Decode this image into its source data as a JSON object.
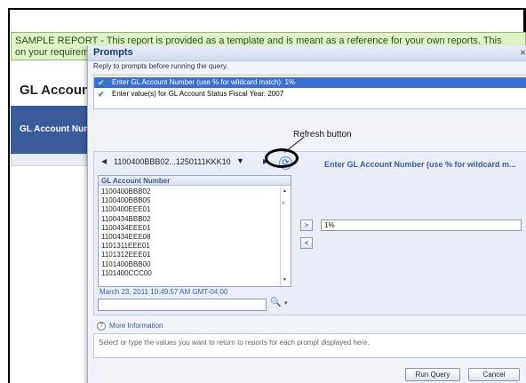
{
  "background": {
    "banner_line1": "SAMPLE REPORT - This report is provided as a template and is meant as a reference for your own reports. This",
    "banner_line2": "on your requirements",
    "report_title": "GL Account",
    "column_header": "GL Account Number"
  },
  "dialog": {
    "title": "Prompts",
    "close_glyph": "×",
    "subtitle": "Reply to prompts before running the query.",
    "prompts": [
      {
        "check": "✔",
        "text": "Enter GL Account Number (use % for wildcard match): 1%"
      },
      {
        "check": "✔",
        "text": "Enter value(s) for GL Account Status Fiscal Year: 2007"
      }
    ],
    "nav": {
      "prev_glyph": "◀",
      "range": "1100400BBB02...1250111KKK10",
      "dropdown_glyph": "▼",
      "next_glyph": "▶",
      "refresh_glyph": "⟳"
    },
    "lov": {
      "header": "GL Account Number",
      "items": [
        "1100400BBB02",
        "1100400BBB05",
        "1100400EEE01",
        "1100434BBB02",
        "1100434EEE01",
        "1100434EEE08",
        "1101311EEE01",
        "1101312EEE01",
        "1101400BBB00",
        "1101400CCC00"
      ],
      "scroll_up": "▲",
      "scroll_mid": "≡",
      "scroll_down": "▼"
    },
    "timestamp": "March 23, 2011 10:49:57 AM GMT-04:00",
    "search": {
      "value": "",
      "binoculars_glyph": "🔍",
      "dropdown_glyph": "▾"
    },
    "add_glyph": ">",
    "remove_glyph": "<",
    "enter_label": "Enter GL Account Number (use % for wildcard m...",
    "enter_value": "1%",
    "more_info": {
      "icon": "?",
      "label": "More Information"
    },
    "info_text": "Select or type the values you want to return to reports for each prompt displayed here.",
    "buttons": {
      "run": "Run Query",
      "cancel": "Cancel"
    }
  },
  "annotation": {
    "label": "Refresh button"
  }
}
